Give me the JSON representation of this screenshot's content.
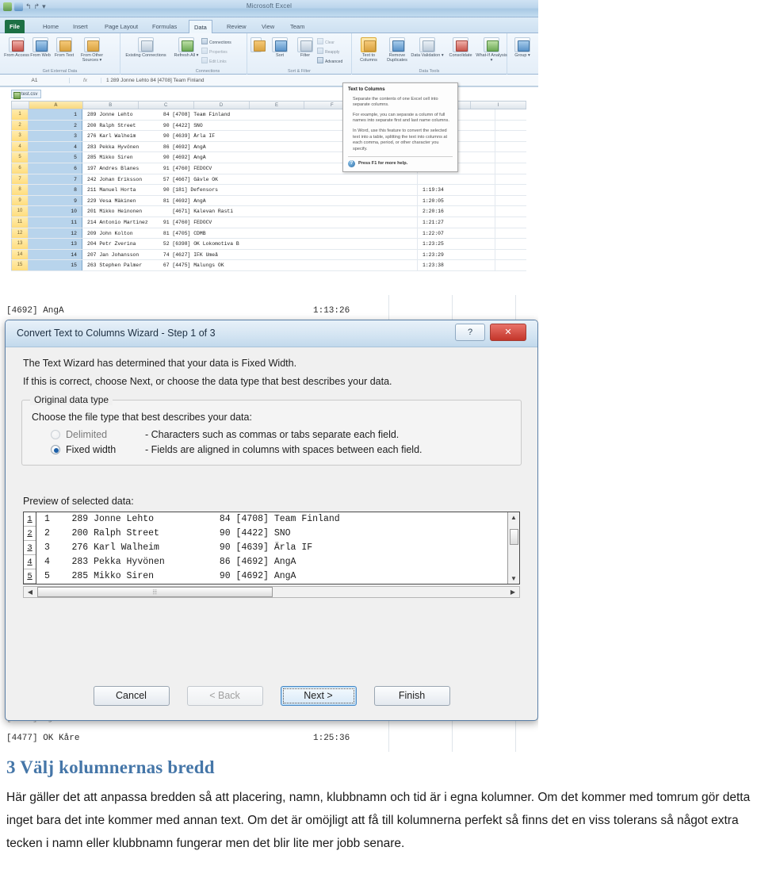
{
  "document": {
    "heading": "3 Välj kolumnernas bredd",
    "body": "Här gäller det att anpassa bredden så att placering, namn, klubbnamn och tid är i egna kolumner. Om det kommer med tomrum gör detta inget bara det inte kommer med annan text. Om det är omöjligt att få till kolumnerna perfekt så finns det en viss tolerans så något extra tecken i namn eller klubbnamn fungerar men det blir lite mer jobb senare.",
    "heading_color": "#4576a8"
  },
  "excel": {
    "window_title": "Microsoft Excel",
    "quick_access": [
      "save-icon",
      "undo-icon",
      "redo-icon",
      "customize-icon"
    ],
    "tabs": [
      "File",
      "Home",
      "Insert",
      "Page Layout",
      "Formulas",
      "Data",
      "Review",
      "View",
      "Team"
    ],
    "active_tab": "Data",
    "ribbon_groups": [
      {
        "label": "Get External Data",
        "items": [
          {
            "label": "From\nAccess",
            "icon": "from-access-icon"
          },
          {
            "label": "From\nWeb",
            "icon": "from-web-icon"
          },
          {
            "label": "From\nText",
            "icon": "from-text-icon"
          },
          {
            "label": "From Other\nSources ▾",
            "icon": "from-other-sources-icon"
          },
          {
            "label": "Existing\nConnections",
            "icon": "existing-connections-icon"
          }
        ]
      },
      {
        "label": "Connections",
        "items": [
          {
            "label": "Refresh\nAll ▾",
            "icon": "refresh-all-icon"
          }
        ],
        "small_items": [
          "Connections",
          "Properties",
          "Edit Links"
        ]
      },
      {
        "label": "Sort & Filter",
        "items": [
          {
            "label": "Sort",
            "icon": "sort-icon"
          },
          {
            "label": "Filter",
            "icon": "filter-icon"
          }
        ],
        "small_items": [
          "Clear",
          "Reapply",
          "Advanced"
        ]
      },
      {
        "label": "Data Tools",
        "items": [
          {
            "label": "Text to\nColumns",
            "icon": "text-to-columns-icon",
            "highlighted": true
          },
          {
            "label": "Remove\nDuplicates",
            "icon": "remove-duplicates-icon"
          },
          {
            "label": "Data\nValidation ▾",
            "icon": "data-validation-icon"
          },
          {
            "label": "Consolidate",
            "icon": "consolidate-icon"
          },
          {
            "label": "What-If\nAnalysis ▾",
            "icon": "what-if-analysis-icon"
          }
        ]
      },
      {
        "label": "",
        "items": [
          {
            "label": "Group ▾",
            "icon": "group-icon"
          }
        ]
      }
    ],
    "formula_bar": {
      "name_box": "A1",
      "fx": "fx",
      "content": "1   289 Jonne Lehto          84 [4708] Team Finland"
    },
    "workbook_tab": "test.csv",
    "column_headers": [
      "A",
      "B",
      "C",
      "D",
      "E",
      "F",
      "G",
      "H",
      "I"
    ],
    "selected_column": "A",
    "rows": [
      {
        "n": "1",
        "a": "1",
        "text": "289 Jonne Lehto          84 [4708] Team Finland",
        "time": ""
      },
      {
        "n": "2",
        "a": "2",
        "text": "200 Ralph Street         90 [4422] SNO",
        "time": ""
      },
      {
        "n": "3",
        "a": "3",
        "text": "276 Karl Walheim         90 [4639] Ärla IF",
        "time": ""
      },
      {
        "n": "4",
        "a": "4",
        "text": "283 Pekka Hyvönen        86 [4692] AngA",
        "time": ""
      },
      {
        "n": "5",
        "a": "5",
        "text": "285 Mikko Siren          90 [4692] AngA",
        "time": ""
      },
      {
        "n": "6",
        "a": "6",
        "text": "197 Andres Blanes        91 [4760] FEDOCV",
        "time": ""
      },
      {
        "n": "7",
        "a": "7",
        "text": "242 Johan Eriksson       57 [4667] Gävle OK",
        "time": ""
      },
      {
        "n": "8",
        "a": "8",
        "text": "211 Manuel Horta         90 [181] Defensors",
        "time": "1:19:34"
      },
      {
        "n": "9",
        "a": "9",
        "text": "229 Vesa Mäkinen         81 [4692] AngA",
        "time": "1:20:05"
      },
      {
        "n": "10",
        "a": "10",
        "text": "201 Mikko Heinonen          [4671] Kalevan Rasti",
        "time": "2:20:16"
      },
      {
        "n": "11",
        "a": "11",
        "text": "214 Antonio Martinez     91 [4760] FEDOCV",
        "time": "1:21:27"
      },
      {
        "n": "12",
        "a": "12",
        "text": "209 John Kolton          81 [4705] CDMB",
        "time": "1:22:07"
      },
      {
        "n": "13",
        "a": "13",
        "text": "204 Petr Zverina         52 [6398] OK Lokomotiva B",
        "time": "1:23:25"
      },
      {
        "n": "14",
        "a": "14",
        "text": "207 Jan Johansson        74 [4627] IFK Umeå",
        "time": "1:23:29"
      },
      {
        "n": "15",
        "a": "15",
        "text": "263 Stephen Palmer       67 [4475] Malungs OK",
        "time": "1:23:38"
      }
    ],
    "tooltip": {
      "title": "Text to Columns",
      "paragraphs": [
        "Separate the contents of one Excel cell into separate columns.",
        "For example, you can separate a column of full names into separate first and last name columns.",
        "In Word, use this feature to convert the selected text into a table, splitting the text into columns at each comma, period, or other character you specify."
      ],
      "footer": "Press F1 for more help.",
      "footer_icon": "help-icon"
    },
    "behind_rows": [
      {
        "text": "[4692] AngA",
        "time": "1:13:26"
      },
      {
        "text": "[4465] Sjövalla FK",
        "time": "1:25:12"
      },
      {
        "text": "[4477] OK Kåre",
        "time": "1:25:36"
      }
    ]
  },
  "dialog": {
    "title": "Convert Text to Columns Wizard - Step 1 of 3",
    "help_button": "?",
    "close_button": "✕",
    "line1": "The Text Wizard has determined that your data is Fixed Width.",
    "line2": "If this is correct, choose Next, or choose the data type that best describes your data.",
    "group_legend": "Original data type",
    "group_prompt": "Choose the file type that best describes your data:",
    "options": [
      {
        "label": "Delimited",
        "underline": "D",
        "description": "- Characters such as commas or tabs separate each field.",
        "checked": false,
        "enabled": false
      },
      {
        "label": "Fixed width",
        "underline": "w",
        "description": "- Fields are aligned in columns with spaces between each field.",
        "checked": true,
        "enabled": true
      }
    ],
    "preview_label": "Preview of selected data:",
    "preview_gutter": [
      "1",
      "2",
      "3",
      "4",
      "5"
    ],
    "preview_lines": [
      "1    289 Jonne Lehto            84 [4708] Team Finland",
      "2    200 Ralph Street           90 [4422] SNO",
      "3    276 Karl Walheim           90 [4639] Ärla IF",
      "4    283 Pekka Hyvönen          86 [4692] AngA",
      "5    285 Mikko Siren            90 [4692] AngA"
    ],
    "scroll": {
      "up": "▲",
      "down": "▼",
      "left": "◀",
      "right": "▶",
      "grip": "⦙⦙⦙"
    },
    "buttons": [
      {
        "label": "Cancel",
        "state": "normal",
        "underline": ""
      },
      {
        "label": "< Back",
        "state": "disabled",
        "underline": ""
      },
      {
        "label": "Next >",
        "state": "focused",
        "underline": "N"
      },
      {
        "label": "Finish",
        "state": "normal",
        "underline": "F"
      }
    ]
  }
}
